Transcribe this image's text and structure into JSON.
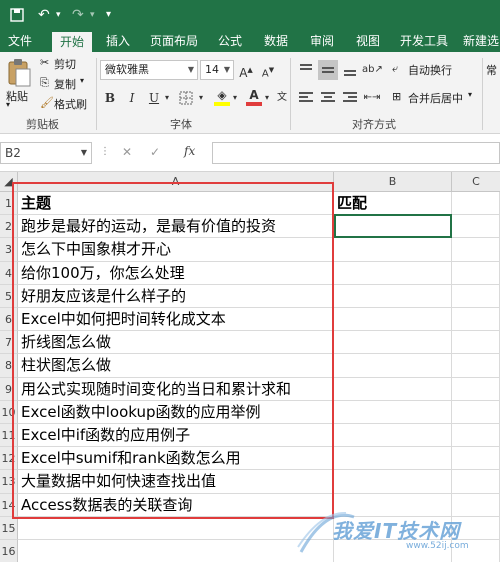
{
  "quick_access": {
    "save_icon": "save-icon",
    "undo_icon": "undo-icon",
    "redo_icon": "redo-icon"
  },
  "tabs": [
    {
      "label": "文件"
    },
    {
      "label": "开始"
    },
    {
      "label": "插入"
    },
    {
      "label": "页面布局"
    },
    {
      "label": "公式"
    },
    {
      "label": "数据"
    },
    {
      "label": "审阅"
    },
    {
      "label": "视图"
    },
    {
      "label": "开发工具"
    },
    {
      "label": "新建选"
    }
  ],
  "active_tab": "开始",
  "ribbon": {
    "paste_label": "粘贴",
    "cut_label": "剪切",
    "copy_label": "复制",
    "format_painter_label": "格式刷",
    "clipboard_group": "剪贴板",
    "font_name": "微软雅黑",
    "font_size": "14",
    "font_group": "字体",
    "wrap_text_label": "自动换行",
    "merge_center_label": "合并后居中",
    "align_group": "对齐方式",
    "font_color": "#e03c3c",
    "fill_color": "#ffff00"
  },
  "formula_bar": {
    "name_box": "B2",
    "fx_label": "fx",
    "cancel": "✕",
    "confirm": "✓"
  },
  "columns": [
    "A",
    "B",
    "C"
  ],
  "rows": [
    {
      "num": "1",
      "a": "主题",
      "b": "匹配"
    },
    {
      "num": "2",
      "a": "跑步是最好的运动，是最有价值的投资",
      "b": ""
    },
    {
      "num": "3",
      "a": "怎么下中国象棋才开心",
      "b": ""
    },
    {
      "num": "4",
      "a": "给你100万，你怎么处理",
      "b": ""
    },
    {
      "num": "5",
      "a": "好朋友应该是什么样子的",
      "b": ""
    },
    {
      "num": "6",
      "a": "Excel中如何把时间转化成文本",
      "b": ""
    },
    {
      "num": "7",
      "a": "折线图怎么做",
      "b": ""
    },
    {
      "num": "8",
      "a": "柱状图怎么做",
      "b": ""
    },
    {
      "num": "9",
      "a": "用公式实现随时间变化的当日和累计求和",
      "b": ""
    },
    {
      "num": "10",
      "a": "Excel函数中lookup函数的应用举例",
      "b": ""
    },
    {
      "num": "11",
      "a": "Excel中if函数的应用例子",
      "b": ""
    },
    {
      "num": "12",
      "a": "Excel中sumif和rank函数怎么用",
      "b": ""
    },
    {
      "num": "13",
      "a": "大量数据中如何快速查找出值",
      "b": ""
    },
    {
      "num": "14",
      "a": "Access数据表的关联查询",
      "b": ""
    },
    {
      "num": "15",
      "a": "",
      "b": ""
    },
    {
      "num": "16",
      "a": "",
      "b": ""
    }
  ],
  "watermark": {
    "text": "我爱IT技术网",
    "url": "www.52ij.com"
  }
}
